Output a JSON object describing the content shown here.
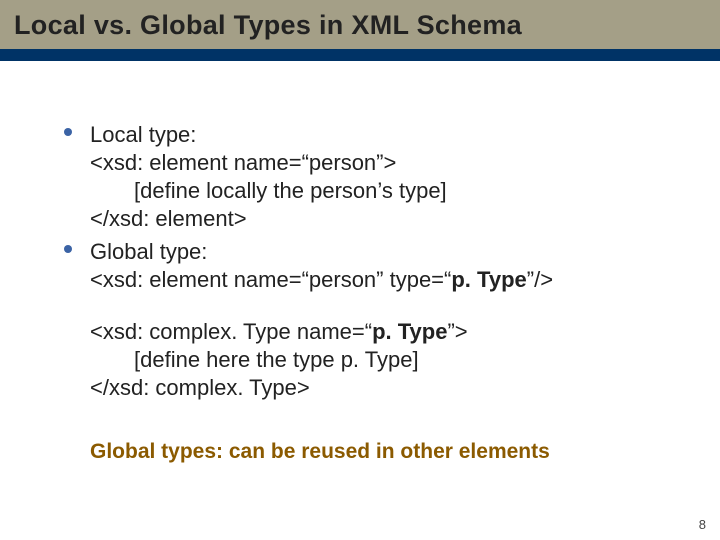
{
  "title": "Local vs. Global Types in XML Schema",
  "bullets": [
    {
      "label": "Local type:",
      "lines": [
        "<xsd: element name=“person”>",
        "[define locally the person’s type]",
        "</xsd: element>"
      ]
    },
    {
      "label": "Global type:",
      "line_pre": "<xsd: element name=“person” type=“",
      "line_bold": "p. Type",
      "line_post": "”/>"
    }
  ],
  "orphan": {
    "l1_pre": "<xsd: complex. Type name=“",
    "l1_bold": "p. Type",
    "l1_post": "”>",
    "l2": "[define here the type p. Type]",
    "l3": "</xsd: complex. Type>"
  },
  "footnote": "Global types: can be reused in other elements",
  "page": "8"
}
